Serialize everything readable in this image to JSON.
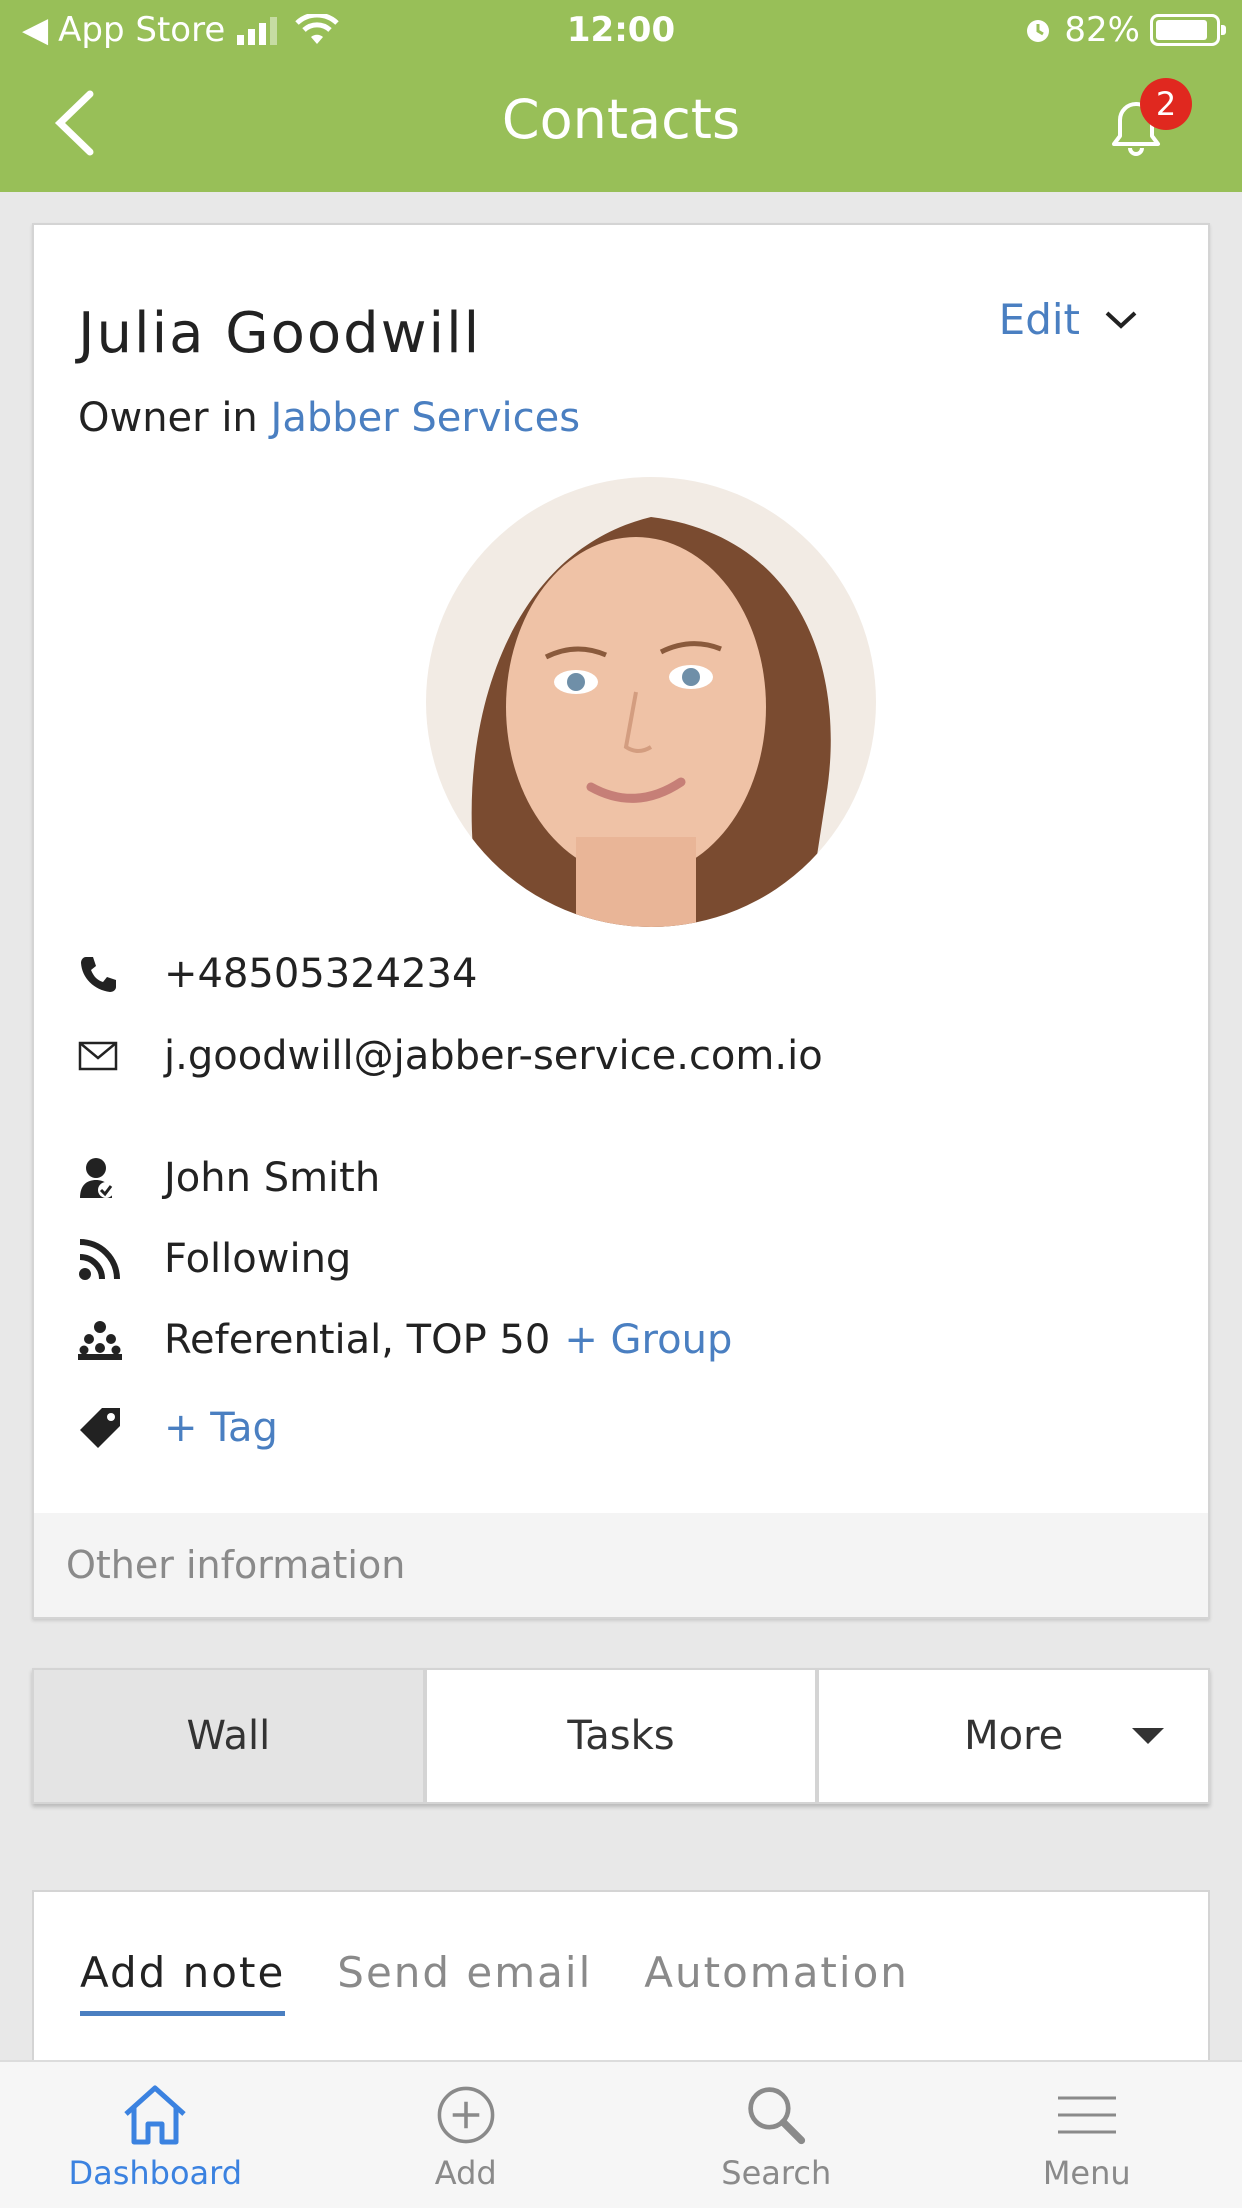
{
  "status_bar": {
    "back_app": "App Store",
    "time": "12:00",
    "battery": "82%"
  },
  "header": {
    "title": "Contacts",
    "notification_count": "2"
  },
  "contact": {
    "name": "Julia Goodwill",
    "edit_label": "Edit",
    "role_prefix": "Owner in",
    "company": "Jabber Services",
    "phone": "+48505324234",
    "email": "j.goodwill@jabber-service.com.io",
    "owner": "John Smith",
    "follow_status": "Following",
    "groups": "Referential, TOP 50",
    "add_group": "+ Group",
    "add_tag": "+ Tag",
    "other_info": "Other information"
  },
  "tabs": [
    {
      "label": "Wall"
    },
    {
      "label": "Tasks"
    },
    {
      "label": "More"
    }
  ],
  "note_tabs": [
    {
      "label": "Add note"
    },
    {
      "label": "Send email"
    },
    {
      "label": "Automation"
    }
  ],
  "bottom_nav": [
    {
      "label": "Dashboard",
      "icon": "home-icon"
    },
    {
      "label": "Add",
      "icon": "plus-circle-icon"
    },
    {
      "label": "Search",
      "icon": "search-icon"
    },
    {
      "label": "Menu",
      "icon": "menu-icon"
    }
  ],
  "colors": {
    "header_green": "#98bf58",
    "link_blue": "#4a7fc1",
    "badge_red": "#e0281f",
    "active_nav": "#3b82e0"
  }
}
